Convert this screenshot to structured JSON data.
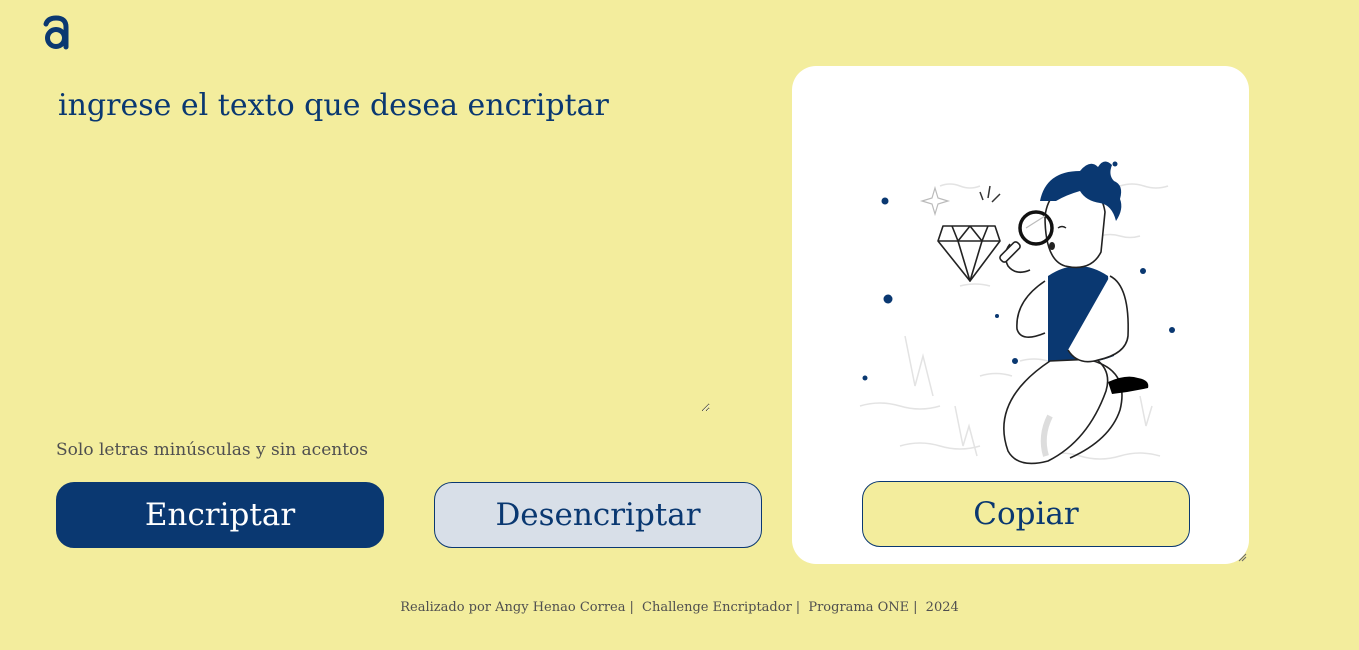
{
  "app": {
    "logo_icon": "alura-logo-icon",
    "accent_color": "#0a3871",
    "background_color": "#f3ed9d"
  },
  "main": {
    "input_placeholder": "ingrese el texto que desea encriptar",
    "input_value": "",
    "hint": "Solo letras minúsculas y sin acentos",
    "encrypt_label": "Encriptar",
    "decrypt_label": "Desencriptar"
  },
  "output_panel": {
    "illustration": "person-with-magnifying-glass-and-diamond-illustration",
    "copy_label": "Copiar"
  },
  "footer": {
    "items": [
      "Realizado por Angy Henao Correa",
      "Challenge Encriptador",
      "Programa ONE",
      "2024"
    ],
    "separator": "|"
  }
}
